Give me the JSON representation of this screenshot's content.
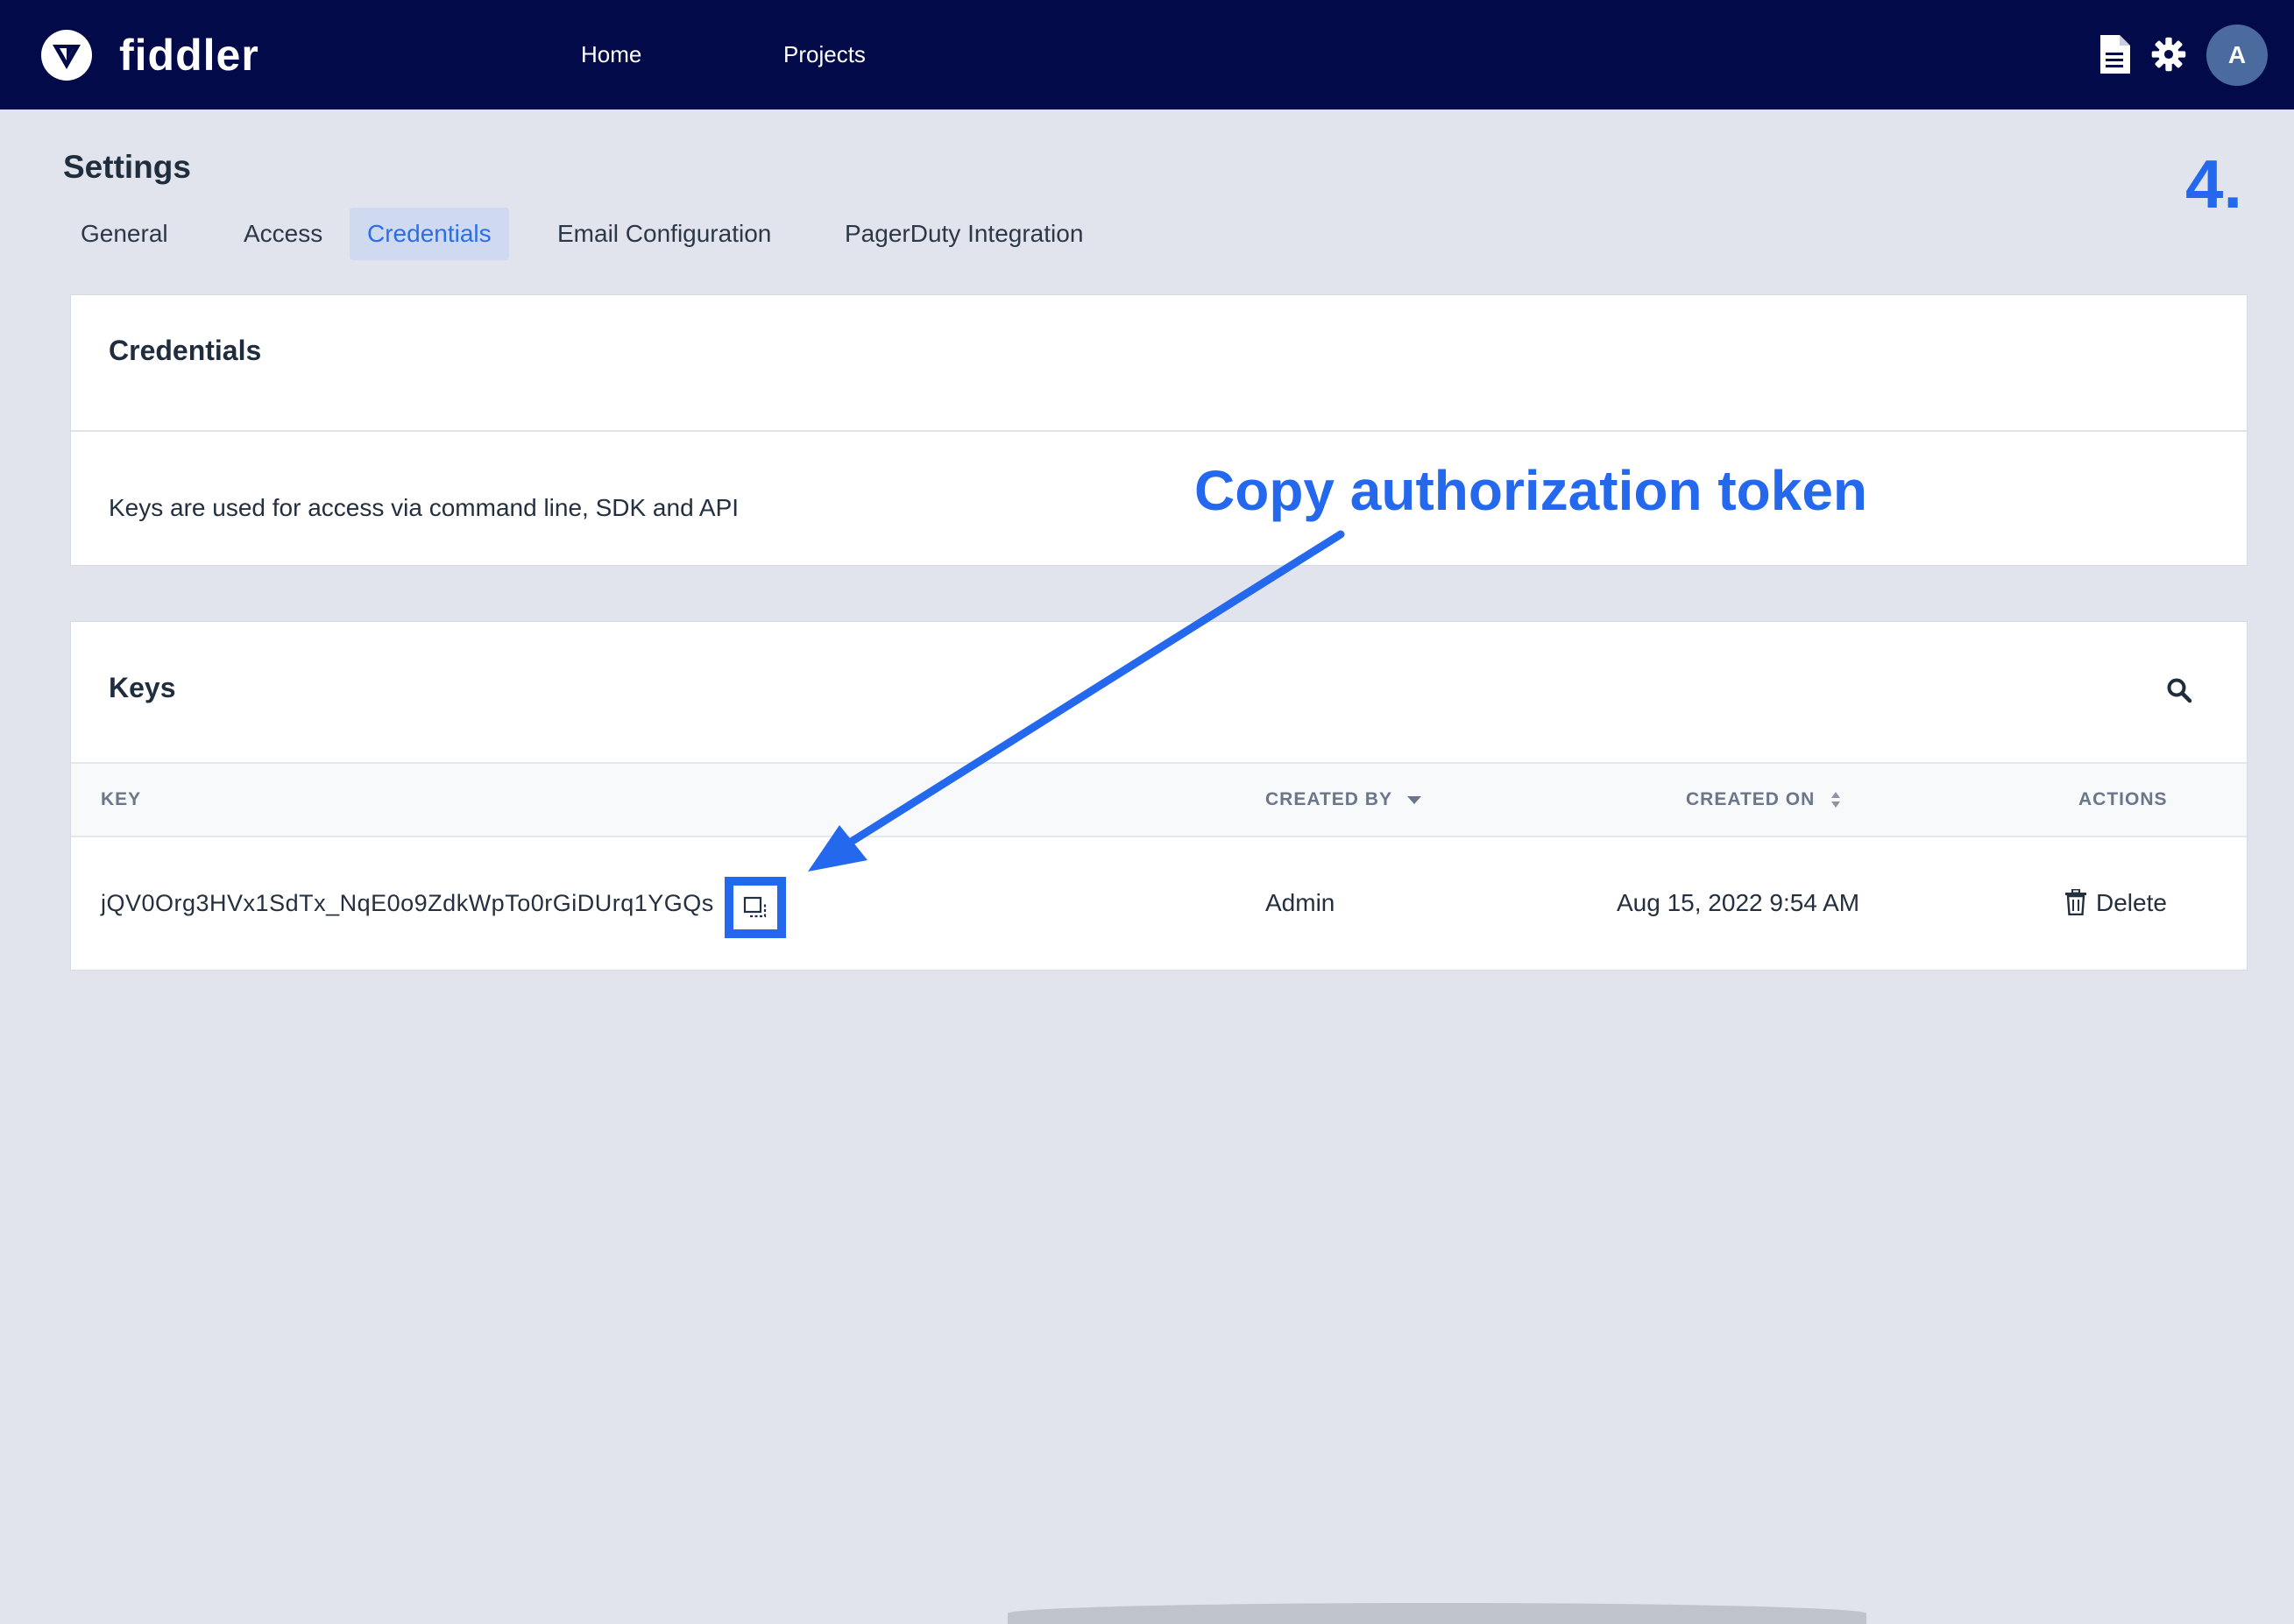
{
  "app": {
    "logo_text": "fiddler"
  },
  "nav": {
    "home": "Home",
    "projects": "Projects"
  },
  "user": {
    "avatar_initial": "A"
  },
  "settings": {
    "title": "Settings",
    "tabs": [
      {
        "label": "General"
      },
      {
        "label": "Access"
      },
      {
        "label": "Credentials",
        "active": true
      },
      {
        "label": "Email Configuration"
      },
      {
        "label": "PagerDuty Integration"
      }
    ]
  },
  "credentials_panel": {
    "heading": "Credentials",
    "description": "Keys are used for access via command line, SDK and API"
  },
  "keys_panel": {
    "heading": "Keys",
    "columns": {
      "key": "KEY",
      "created_by": "CREATED BY",
      "created_on": "CREATED ON",
      "actions": "ACTIONS"
    },
    "rows": [
      {
        "key": "jQV0Org3HVx1SdTx_NqE0o9ZdkWpTo0rGiDUrq1YGQs",
        "created_by": "Admin",
        "created_on": "Aug 15, 2022 9:54 AM",
        "action_label": "Delete"
      }
    ]
  },
  "annotation": {
    "step": "4.",
    "callout": "Copy authorization token",
    "color": "#2468ee"
  },
  "colors": {
    "topbar": "#020a4a",
    "background": "#e1e4ec",
    "accent": "#2a6ee8",
    "active_tab_bg": "#cfdaf0"
  },
  "icons": [
    "fiddler-logo-icon",
    "document-icon",
    "gear-icon",
    "search-icon",
    "sort-down-icon",
    "sort-both-icon",
    "copy-icon",
    "trash-icon"
  ]
}
